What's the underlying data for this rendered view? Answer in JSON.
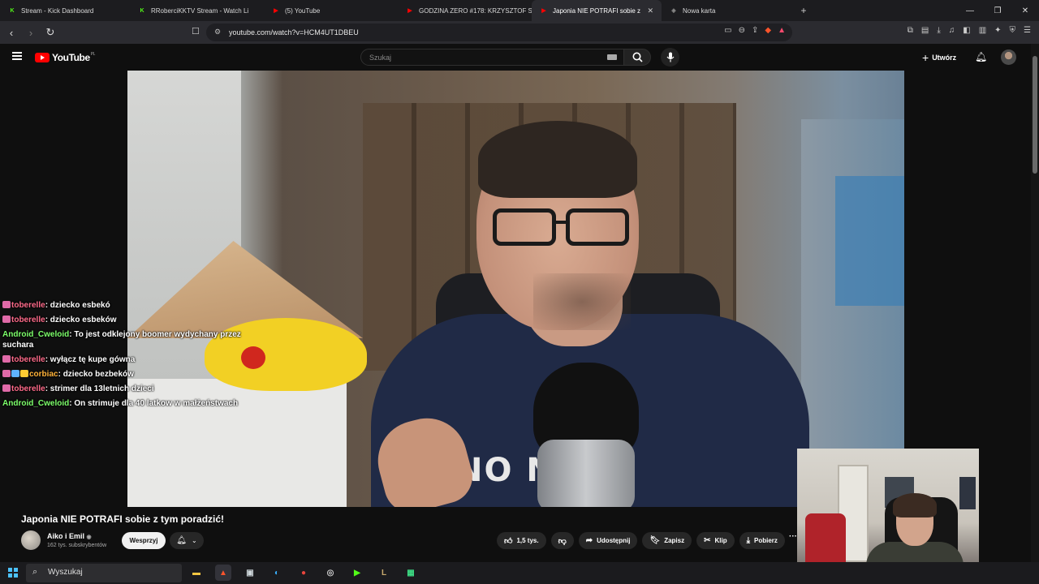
{
  "browser": {
    "tabs": [
      {
        "label": "Stream - Kick Dashboard",
        "fav_color": "#53fc18",
        "fav_text": "K"
      },
      {
        "label": "RRoberciKKTV Stream - Watch Li",
        "fav_color": "#53fc18",
        "fav_text": "K"
      },
      {
        "label": "(5) YouTube",
        "fav_color": "#ff0000",
        "fav_text": "▶"
      },
      {
        "label": "GODZINA ZERO #178: KRZYSZTOF ST",
        "fav_color": "#ff0000",
        "fav_text": "▶"
      },
      {
        "label": "Japonia NIE POTRAFI sobie z",
        "fav_color": "#ff0000",
        "fav_text": "▶",
        "active": true
      },
      {
        "label": "Nowa karta",
        "fav_color": "#888888",
        "fav_text": "◈"
      }
    ],
    "new_tab": "+",
    "url": "youtube.com/watch?v=HCM4UT1DBEU"
  },
  "youtube": {
    "logo_text": "YouTube",
    "region": "PL",
    "search_placeholder": "Szukaj",
    "create_label": "Utwórz"
  },
  "chat": [
    {
      "user": "toberelle",
      "color": "#ff6b8a",
      "text": "dziecko esbekó",
      "emotes": 1
    },
    {
      "user": "toberelle",
      "color": "#ff6b8a",
      "text": "dziecko esbeków",
      "emotes": 1
    },
    {
      "user": "Android_Cweloid",
      "color": "#7dff6b",
      "text": "To jest odklejony boomer wydychany przez suchara",
      "emotes": 0
    },
    {
      "user": "toberelle",
      "color": "#ff6b8a",
      "text": "wyłącz tę kupe gówna",
      "emotes": 1
    },
    {
      "user": "corbiac",
      "color": "#ffb33a",
      "text": "dziecko bezbeków",
      "emotes": 3
    },
    {
      "user": "toberelle",
      "color": "#ff6b8a",
      "text": "strimer dla 13letnich dzieci",
      "emotes": 1
    },
    {
      "user": "Android_Cweloid",
      "color": "#7dff6b",
      "text": "On strimuje dla 40 latkow w małżeństwach",
      "emotes": 0
    }
  ],
  "video": {
    "shirt_text": "NO N    JO,",
    "title": "Japonia NIE POTRAFI sobie z tym poradzić!",
    "channel": "Aiko i Emil",
    "verified": "◉",
    "subscribers": "162 tys. subskrybentów",
    "support_label": "Wesprzyj",
    "likes": "1,5 tys.",
    "share_label": "Udostępnij",
    "save_label": "Zapisz",
    "clip_label": "Klip",
    "download_label": "Pobierz",
    "more_label": "···"
  },
  "taskbar": {
    "search_label": "Wyszukaj",
    "apps": [
      {
        "name": "explorer-icon",
        "glyph": "▬",
        "color": "#f4c542"
      },
      {
        "name": "brave-icon",
        "glyph": "▲",
        "color": "#fb542b",
        "active": true
      },
      {
        "name": "terminal-icon",
        "glyph": "▣",
        "color": "#cfd8dc"
      },
      {
        "name": "edge-icon",
        "glyph": "◐",
        "color": "#3ab0ff"
      },
      {
        "name": "chrome-icon",
        "glyph": "●",
        "color": "#e8453c"
      },
      {
        "name": "obs-icon",
        "glyph": "◎",
        "color": "#d0d0d0"
      },
      {
        "name": "kick-icon",
        "glyph": "▶",
        "color": "#53fc18"
      },
      {
        "name": "league-icon",
        "glyph": "L",
        "color": "#c8aa6e"
      },
      {
        "name": "app-icon",
        "glyph": "▦",
        "color": "#3ddc84"
      }
    ]
  }
}
